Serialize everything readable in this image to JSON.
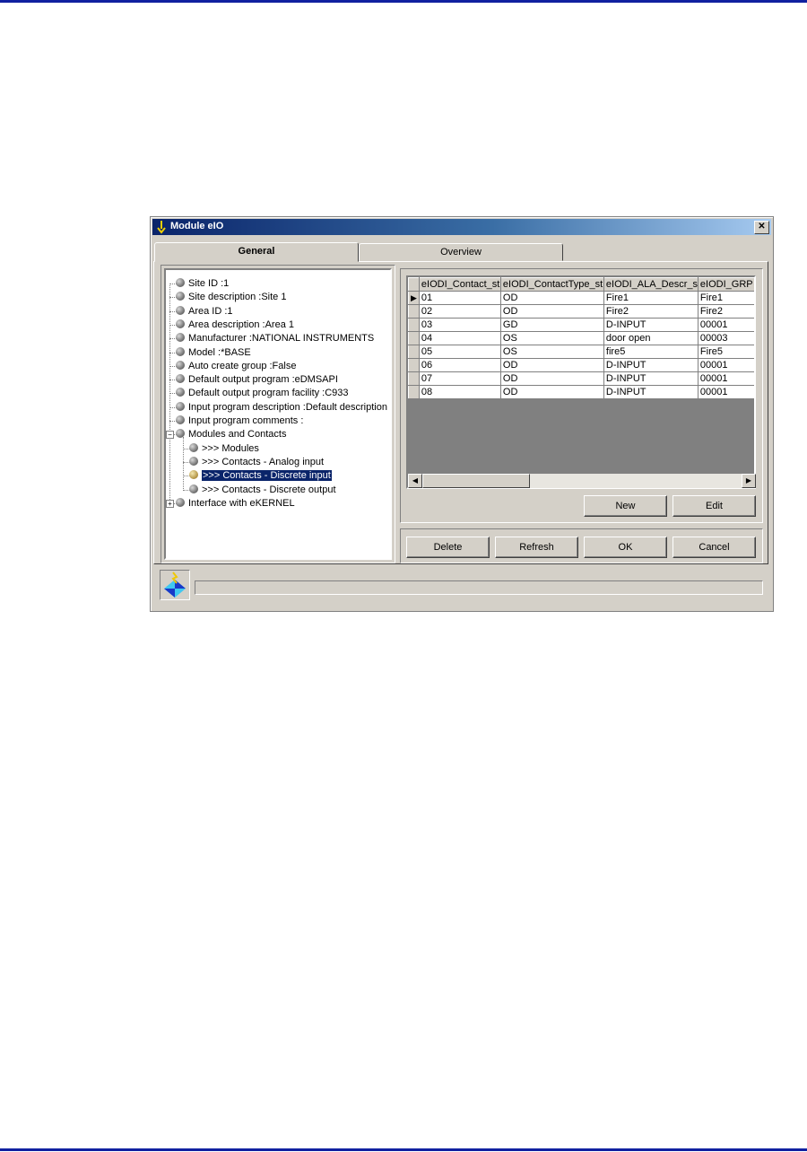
{
  "window": {
    "title": "Module eIO",
    "close_glyph": "✕"
  },
  "tabs": [
    {
      "label": "General",
      "active": true
    },
    {
      "label": "Overview",
      "active": false
    }
  ],
  "tree": {
    "items": [
      {
        "label": "Site ID :1"
      },
      {
        "label": "Site description :Site 1"
      },
      {
        "label": "Area ID :1"
      },
      {
        "label": "Area description :Area 1"
      },
      {
        "label": "Manufacturer :NATIONAL INSTRUMENTS"
      },
      {
        "label": "Model :*BASE"
      },
      {
        "label": "Auto create group :False"
      },
      {
        "label": "Default output program :eDMSAPI"
      },
      {
        "label": "Default output program facility :C933"
      },
      {
        "label": "Input program description :Default description"
      },
      {
        "label": "Input program comments :"
      },
      {
        "label": "Modules and Contacts",
        "expander": "−"
      },
      {
        "label": ">>> Modules"
      },
      {
        "label": ">>> Contacts - Analog input"
      },
      {
        "label": ">>> Contacts - Discrete input",
        "selected": true
      },
      {
        "label": ">>> Contacts - Discrete output"
      },
      {
        "label": "Interface with eKERNEL",
        "expander": "+"
      }
    ]
  },
  "grid": {
    "columns": [
      "eIODI_Contact_str",
      "eIODI_ContactType_str",
      "eIODI_ALA_Descr_st",
      "eIODI_GRP"
    ],
    "current_row_marker": "▶",
    "rows": [
      [
        "01",
        "OD",
        "Fire1",
        "Fire1"
      ],
      [
        "02",
        "OD",
        "Fire2",
        "Fire2"
      ],
      [
        "03",
        "GD",
        "D-INPUT",
        "00001"
      ],
      [
        "04",
        "OS",
        "door open",
        "00003"
      ],
      [
        "05",
        "OS",
        "fire5",
        "Fire5"
      ],
      [
        "06",
        "OD",
        "D-INPUT",
        "00001"
      ],
      [
        "07",
        "OD",
        "D-INPUT",
        "00001"
      ],
      [
        "08",
        "OD",
        "D-INPUT",
        "00001"
      ]
    ]
  },
  "scrollbar": {
    "left_arrow": "◀",
    "right_arrow": "▶"
  },
  "buttons": {
    "new": "New",
    "edit": "Edit",
    "delete": "Delete",
    "refresh": "Refresh",
    "ok": "OK",
    "cancel": "Cancel"
  },
  "colors": {
    "page_rule": "#1020a0",
    "title_gradient_start": "#0a246a",
    "selection": "#0a246a",
    "window_face": "#d4d0c8"
  }
}
